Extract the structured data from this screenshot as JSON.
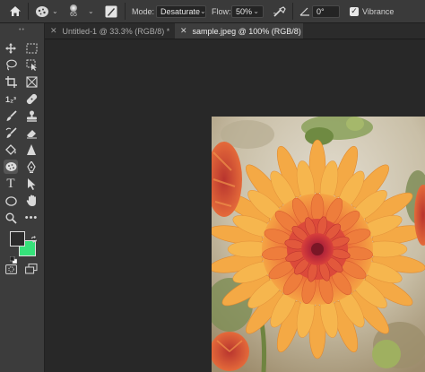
{
  "options_bar": {
    "brush_size": "65",
    "mode_label": "Mode:",
    "mode_value": "Desaturate",
    "flow_label": "Flow:",
    "flow_value": "50%",
    "angle_value": "0°",
    "vibrance_label": "Vibrance",
    "vibrance_checked": true
  },
  "tabs": [
    {
      "label": "Untitled-1 @ 33.3% (RGB/8) *",
      "active": false
    },
    {
      "label": "sample.jpeg @ 100% (RGB/8)",
      "active": true
    }
  ],
  "toolbar": {
    "grip": "••",
    "tools": [
      "move-tool",
      "artboard-tool",
      "lasso-tool",
      "object-selection-tool",
      "crop-tool",
      "frame-tool",
      "count-tool",
      "healing-brush-tool",
      "brush-tool",
      "clone-stamp-tool",
      "history-brush-tool",
      "eraser-tool",
      "paint-bucket-tool",
      "sharpen-tool",
      "sponge-tool",
      "pen-tool",
      "type-tool",
      "path-selection-tool",
      "ellipse-tool",
      "hand-tool",
      "zoom-tool",
      "more-tools"
    ],
    "foreground_color": "#2b2b2b",
    "background_color": "#36e27a"
  }
}
